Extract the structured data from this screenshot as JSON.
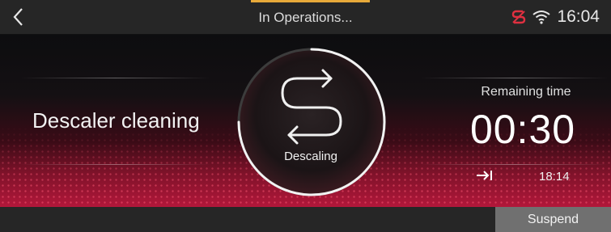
{
  "header": {
    "back_icon": "chevron-left-icon",
    "title": "In Operations...",
    "status": {
      "remote_icon": "remote-connect-icon",
      "wifi_icon": "wifi-icon",
      "time": "16:04"
    }
  },
  "program": {
    "name": "Descaler cleaning"
  },
  "dial": {
    "icon": "descaling-cycle-icon",
    "label": "Descaling",
    "progress_fraction": 0.75
  },
  "timer": {
    "remaining_label": "Remaining time",
    "remaining_value": "00:30",
    "end_icon": "end-time-icon",
    "end_time": "18:14"
  },
  "footer": {
    "suspend_label": "Suspend"
  },
  "colors": {
    "accent": "#e7a93a",
    "remote_icon": "#e03040",
    "brand_red": "#b2173a"
  }
}
